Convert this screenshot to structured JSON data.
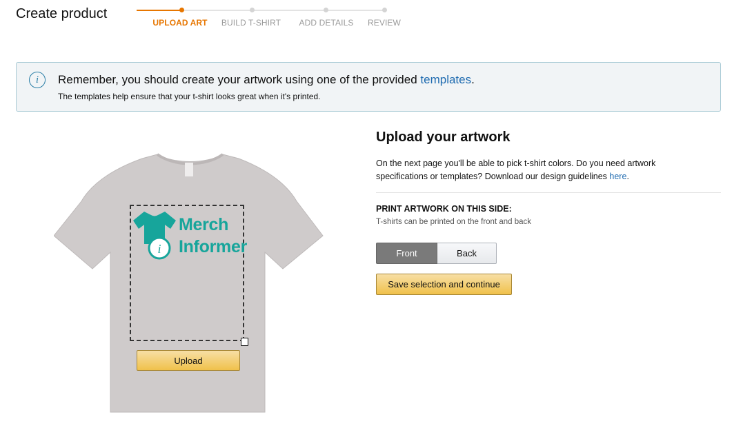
{
  "header": {
    "title": "Create product",
    "steps": [
      {
        "label": "UPLOAD ART",
        "state": "active"
      },
      {
        "label": "BUILD T-SHIRT",
        "state": "inactive"
      },
      {
        "label": "ADD DETAILS",
        "state": "inactive"
      },
      {
        "label": "REVIEW",
        "state": "inactive"
      }
    ]
  },
  "banner": {
    "icon": "info-icon",
    "text_before_link": "Remember, you should create your artwork using one of the provided ",
    "link": "templates",
    "text_after_link": ".",
    "subtext": "The templates help ensure that your t-shirt looks great when it's printed."
  },
  "preview": {
    "logo_line1": "Merch",
    "logo_line2": "Informer",
    "delete_icon": "trash-icon",
    "upload_label": "Upload"
  },
  "panel": {
    "heading": "Upload your artwork",
    "description_before_link": "On the next page you'll be able to pick t-shirt colors. Do you need artwork specifications or templates? Download our design guidelines ",
    "description_link": "here",
    "description_after_link": ".",
    "side_heading": "PRINT ARTWORK ON THIS SIDE:",
    "side_sub": "T-shirts can be printed on the front and back",
    "side_options": [
      "Front",
      "Back"
    ],
    "selected_side": "Front",
    "save_label": "Save selection and continue"
  },
  "colors": {
    "accent_orange": "#e77600",
    "link_blue": "#1f6bb0",
    "shirt_gray": "#cfcbcb",
    "logo_teal": "#17a59b",
    "button_yellow": "#f0c14b"
  }
}
